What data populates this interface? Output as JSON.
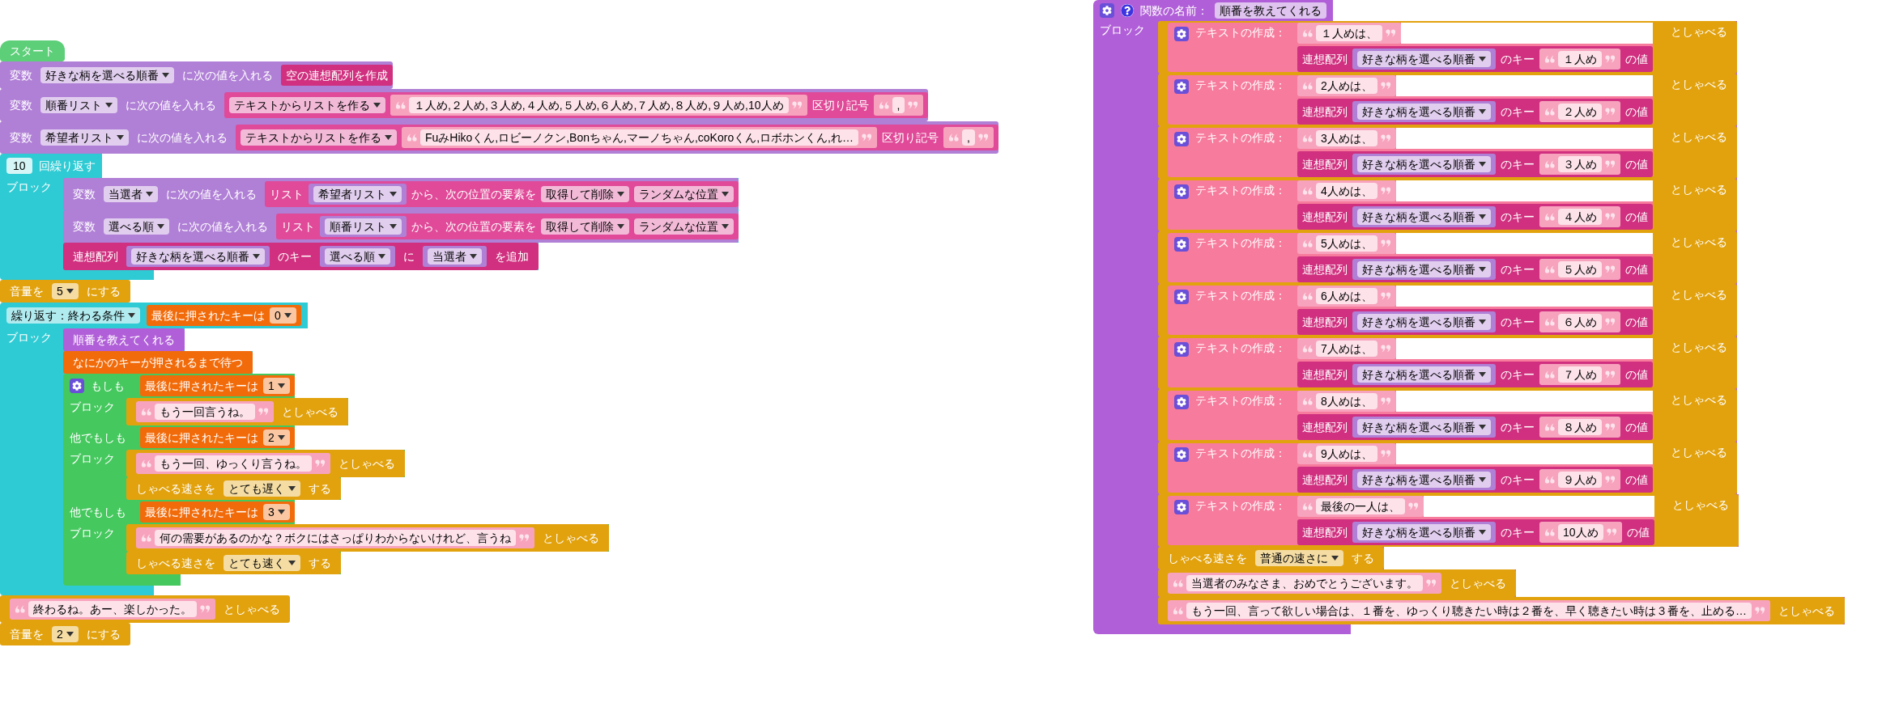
{
  "main_script": [
    {
      "kind": "hat",
      "color": "#5ccf78",
      "parts": [
        {
          "kind": "label",
          "text": "スタート"
        }
      ]
    },
    {
      "kind": "statement",
      "color": "#b07fd6",
      "parts": [
        {
          "kind": "label",
          "text": "変数"
        },
        {
          "kind": "dropdown",
          "text": "好きな柄を選べる順番"
        },
        {
          "kind": "label",
          "text": "に次の値を入れる"
        },
        {
          "kind": "value",
          "color": "#d0307f",
          "parts": [
            {
              "kind": "label",
              "text": "空の連想配列を作成"
            }
          ]
        }
      ]
    },
    {
      "kind": "statement",
      "color": "#b07fd6",
      "parts": [
        {
          "kind": "label",
          "text": "変数"
        },
        {
          "kind": "dropdown",
          "text": "順番リスト"
        },
        {
          "kind": "label",
          "text": "に次の値を入れる"
        },
        {
          "kind": "value",
          "color": "#e04a98",
          "parts": [
            {
              "kind": "dropdown",
              "text": "テキストからリストを作る"
            },
            {
              "kind": "string",
              "text": "１人め,２人め,３人め,４人め,５人め,６人め,７人め,８人め,９人め,10人め"
            },
            {
              "kind": "label",
              "text": "区切り記号"
            },
            {
              "kind": "string",
              "text": ","
            }
          ]
        }
      ]
    },
    {
      "kind": "statement",
      "color": "#b07fd6",
      "parts": [
        {
          "kind": "label",
          "text": "変数"
        },
        {
          "kind": "dropdown",
          "text": "希望者リスト"
        },
        {
          "kind": "label",
          "text": "に次の値を入れる"
        },
        {
          "kind": "value",
          "color": "#e04a98",
          "parts": [
            {
              "kind": "dropdown",
              "text": "テキストからリストを作る"
            },
            {
              "kind": "string",
              "text": "FuみHikoくん,ロビーノクン,Bonちゃん,マーノちゃん,coKoroくん,ロボホンくん,れ…"
            },
            {
              "kind": "label",
              "text": "区切り記号"
            },
            {
              "kind": "string",
              "text": ","
            }
          ]
        }
      ]
    },
    {
      "kind": "loop",
      "color": "#2ecbd4",
      "parts": [
        {
          "kind": "number",
          "text": "10"
        },
        {
          "kind": "label",
          "text": "回繰り返す"
        }
      ],
      "body_label": "ブロック",
      "body": [
        {
          "kind": "statement",
          "color": "#b07fd6",
          "parts": [
            {
              "kind": "label",
              "text": "変数"
            },
            {
              "kind": "dropdown",
              "text": "当選者"
            },
            {
              "kind": "label",
              "text": "に次の値を入れる"
            },
            {
              "kind": "value",
              "color": "#e04a98",
              "parts": [
                {
                  "kind": "label",
                  "text": "リスト"
                },
                {
                  "kind": "value",
                  "color": "#b07fd6",
                  "parts": [
                    {
                      "kind": "dropdown",
                      "text": "希望者リスト"
                    }
                  ]
                },
                {
                  "kind": "label",
                  "text": "から、次の位置の要素を"
                },
                {
                  "kind": "dropdown",
                  "text": "取得して削除"
                },
                {
                  "kind": "dropdown",
                  "text": "ランダムな位置"
                }
              ]
            }
          ]
        },
        {
          "kind": "statement",
          "color": "#b07fd6",
          "parts": [
            {
              "kind": "label",
              "text": "変数"
            },
            {
              "kind": "dropdown",
              "text": "選べる順"
            },
            {
              "kind": "label",
              "text": "に次の値を入れる"
            },
            {
              "kind": "value",
              "color": "#e04a98",
              "parts": [
                {
                  "kind": "label",
                  "text": "リスト"
                },
                {
                  "kind": "value",
                  "color": "#b07fd6",
                  "parts": [
                    {
                      "kind": "dropdown",
                      "text": "順番リスト"
                    }
                  ]
                },
                {
                  "kind": "label",
                  "text": "から、次の位置の要素を"
                },
                {
                  "kind": "dropdown",
                  "text": "取得して削除"
                },
                {
                  "kind": "dropdown",
                  "text": "ランダムな位置"
                }
              ]
            }
          ]
        },
        {
          "kind": "statement",
          "color": "#d0307f",
          "parts": [
            {
              "kind": "label",
              "text": "連想配列"
            },
            {
              "kind": "value",
              "color": "#b07fd6",
              "parts": [
                {
                  "kind": "dropdown",
                  "text": "好きな柄を選べる順番"
                }
              ]
            },
            {
              "kind": "label",
              "text": "のキー"
            },
            {
              "kind": "value",
              "color": "#b07fd6",
              "parts": [
                {
                  "kind": "dropdown",
                  "text": "選べる順"
                }
              ]
            },
            {
              "kind": "label",
              "text": "に"
            },
            {
              "kind": "value",
              "color": "#b07fd6",
              "parts": [
                {
                  "kind": "dropdown",
                  "text": "当選者"
                }
              ]
            },
            {
              "kind": "label",
              "text": "を追加"
            }
          ]
        }
      ]
    },
    {
      "kind": "statement",
      "color": "#e2a20d",
      "parts": [
        {
          "kind": "label",
          "text": "音量を"
        },
        {
          "kind": "dropdown",
          "text": "5"
        },
        {
          "kind": "label",
          "text": "にする"
        }
      ]
    },
    {
      "kind": "loop",
      "color": "#2ecbd4",
      "parts": [
        {
          "kind": "dropdown",
          "text": "繰り返す：終わる条件"
        },
        {
          "kind": "value",
          "color": "#f26b0a",
          "parts": [
            {
              "kind": "label",
              "text": "最後に押されたキーは"
            },
            {
              "kind": "dropdown",
              "text": "0"
            }
          ]
        }
      ],
      "body_label": "ブロック",
      "body": [
        {
          "kind": "statement",
          "color": "#b15fd8",
          "parts": [
            {
              "kind": "label",
              "text": "順番を教えてくれる"
            }
          ]
        },
        {
          "kind": "statement",
          "color": "#f26b0a",
          "parts": [
            {
              "kind": "label",
              "text": "なにかのキーが押されるまで待つ"
            }
          ]
        },
        {
          "kind": "if",
          "color": "#45c85e",
          "clauses": [
            {
              "label": "もしも",
              "condition": {
                "kind": "value",
                "color": "#f26b0a",
                "parts": [
                  {
                    "kind": "label",
                    "text": "最後に押されたキーは"
                  },
                  {
                    "kind": "dropdown",
                    "text": "1"
                  }
                ]
              },
              "body_label": "ブロック",
              "body": [
                {
                  "kind": "statement",
                  "color": "#e2a20d",
                  "parts": [
                    {
                      "kind": "string",
                      "text": "もう一回言うね。"
                    },
                    {
                      "kind": "label",
                      "text": "としゃべる"
                    }
                  ]
                }
              ]
            },
            {
              "label": "他でもしも",
              "condition": {
                "kind": "value",
                "color": "#f26b0a",
                "parts": [
                  {
                    "kind": "label",
                    "text": "最後に押されたキーは"
                  },
                  {
                    "kind": "dropdown",
                    "text": "2"
                  }
                ]
              },
              "body_label": "ブロック",
              "body": [
                {
                  "kind": "statement",
                  "color": "#e2a20d",
                  "parts": [
                    {
                      "kind": "string",
                      "text": "もう一回、ゆっくり言うね。"
                    },
                    {
                      "kind": "label",
                      "text": "としゃべる"
                    }
                  ]
                },
                {
                  "kind": "statement",
                  "color": "#e2a20d",
                  "parts": [
                    {
                      "kind": "label",
                      "text": "しゃべる速さを"
                    },
                    {
                      "kind": "dropdown",
                      "text": "とても遅く"
                    },
                    {
                      "kind": "label",
                      "text": "する"
                    }
                  ]
                }
              ]
            },
            {
              "label": "他でもしも",
              "condition": {
                "kind": "value",
                "color": "#f26b0a",
                "parts": [
                  {
                    "kind": "label",
                    "text": "最後に押されたキーは"
                  },
                  {
                    "kind": "dropdown",
                    "text": "3"
                  }
                ]
              },
              "body_label": "ブロック",
              "body": [
                {
                  "kind": "statement",
                  "color": "#e2a20d",
                  "parts": [
                    {
                      "kind": "string",
                      "text": "何の需要があるのかな？ボクにはさっぱりわからないけれど、言うね"
                    },
                    {
                      "kind": "label",
                      "text": "としゃべる"
                    }
                  ]
                },
                {
                  "kind": "statement",
                  "color": "#e2a20d",
                  "parts": [
                    {
                      "kind": "label",
                      "text": "しゃべる速さを"
                    },
                    {
                      "kind": "dropdown",
                      "text": "とても速く"
                    },
                    {
                      "kind": "label",
                      "text": "する"
                    }
                  ]
                }
              ]
            }
          ]
        }
      ]
    },
    {
      "kind": "statement",
      "color": "#e2a20d",
      "parts": [
        {
          "kind": "string",
          "text": "終わるね。あー、楽しかった。"
        },
        {
          "kind": "label",
          "text": "としゃべる"
        }
      ]
    },
    {
      "kind": "statement",
      "color": "#e2a20d",
      "parts": [
        {
          "kind": "label",
          "text": "音量を"
        },
        {
          "kind": "dropdown",
          "text": "2"
        },
        {
          "kind": "label",
          "text": "にする"
        }
      ]
    }
  ],
  "function_block": {
    "label": "関数の名前：",
    "name": "順番を教えてくれる",
    "body_label": "ブロック",
    "body": [
      {
        "kind": "statement",
        "color": "#e2a20d",
        "parts": [
          {
            "kind": "join",
            "color": "#f77b9c",
            "label": "テキストの作成：",
            "inputs": [
              {
                "kind": "string",
                "text": "１人めは、"
              },
              {
                "kind": "value",
                "color": "#d0307f",
                "parts": [
                  {
                    "kind": "label",
                    "text": "連想配列"
                  },
                  {
                    "kind": "value",
                    "color": "#b07fd6",
                    "parts": [
                      {
                        "kind": "dropdown",
                        "text": "好きな柄を選べる順番"
                      }
                    ]
                  },
                  {
                    "kind": "label",
                    "text": "のキー"
                  },
                  {
                    "kind": "string",
                    "text": "１人め"
                  },
                  {
                    "kind": "label",
                    "text": "の値"
                  }
                ]
              }
            ]
          },
          {
            "kind": "label",
            "text": "としゃべる"
          }
        ]
      },
      {
        "kind": "statement",
        "color": "#e2a20d",
        "parts": [
          {
            "kind": "join",
            "color": "#f77b9c",
            "label": "テキストの作成：",
            "inputs": [
              {
                "kind": "string",
                "text": "2人めは、"
              },
              {
                "kind": "value",
                "color": "#d0307f",
                "parts": [
                  {
                    "kind": "label",
                    "text": "連想配列"
                  },
                  {
                    "kind": "value",
                    "color": "#b07fd6",
                    "parts": [
                      {
                        "kind": "dropdown",
                        "text": "好きな柄を選べる順番"
                      }
                    ]
                  },
                  {
                    "kind": "label",
                    "text": "のキー"
                  },
                  {
                    "kind": "string",
                    "text": "２人め"
                  },
                  {
                    "kind": "label",
                    "text": "の値"
                  }
                ]
              }
            ]
          },
          {
            "kind": "label",
            "text": "としゃべる"
          }
        ]
      },
      {
        "kind": "statement",
        "color": "#e2a20d",
        "parts": [
          {
            "kind": "join",
            "color": "#f77b9c",
            "label": "テキストの作成：",
            "inputs": [
              {
                "kind": "string",
                "text": "3人めは、"
              },
              {
                "kind": "value",
                "color": "#d0307f",
                "parts": [
                  {
                    "kind": "label",
                    "text": "連想配列"
                  },
                  {
                    "kind": "value",
                    "color": "#b07fd6",
                    "parts": [
                      {
                        "kind": "dropdown",
                        "text": "好きな柄を選べる順番"
                      }
                    ]
                  },
                  {
                    "kind": "label",
                    "text": "のキー"
                  },
                  {
                    "kind": "string",
                    "text": "３人め"
                  },
                  {
                    "kind": "label",
                    "text": "の値"
                  }
                ]
              }
            ]
          },
          {
            "kind": "label",
            "text": "としゃべる"
          }
        ]
      },
      {
        "kind": "statement",
        "color": "#e2a20d",
        "parts": [
          {
            "kind": "join",
            "color": "#f77b9c",
            "label": "テキストの作成：",
            "inputs": [
              {
                "kind": "string",
                "text": "4人めは、"
              },
              {
                "kind": "value",
                "color": "#d0307f",
                "parts": [
                  {
                    "kind": "label",
                    "text": "連想配列"
                  },
                  {
                    "kind": "value",
                    "color": "#b07fd6",
                    "parts": [
                      {
                        "kind": "dropdown",
                        "text": "好きな柄を選べる順番"
                      }
                    ]
                  },
                  {
                    "kind": "label",
                    "text": "のキー"
                  },
                  {
                    "kind": "string",
                    "text": "４人め"
                  },
                  {
                    "kind": "label",
                    "text": "の値"
                  }
                ]
              }
            ]
          },
          {
            "kind": "label",
            "text": "としゃべる"
          }
        ]
      },
      {
        "kind": "statement",
        "color": "#e2a20d",
        "parts": [
          {
            "kind": "join",
            "color": "#f77b9c",
            "label": "テキストの作成：",
            "inputs": [
              {
                "kind": "string",
                "text": "5人めは、"
              },
              {
                "kind": "value",
                "color": "#d0307f",
                "parts": [
                  {
                    "kind": "label",
                    "text": "連想配列"
                  },
                  {
                    "kind": "value",
                    "color": "#b07fd6",
                    "parts": [
                      {
                        "kind": "dropdown",
                        "text": "好きな柄を選べる順番"
                      }
                    ]
                  },
                  {
                    "kind": "label",
                    "text": "のキー"
                  },
                  {
                    "kind": "string",
                    "text": "５人め"
                  },
                  {
                    "kind": "label",
                    "text": "の値"
                  }
                ]
              }
            ]
          },
          {
            "kind": "label",
            "text": "としゃべる"
          }
        ]
      },
      {
        "kind": "statement",
        "color": "#e2a20d",
        "parts": [
          {
            "kind": "join",
            "color": "#f77b9c",
            "label": "テキストの作成：",
            "inputs": [
              {
                "kind": "string",
                "text": "6人めは、"
              },
              {
                "kind": "value",
                "color": "#d0307f",
                "parts": [
                  {
                    "kind": "label",
                    "text": "連想配列"
                  },
                  {
                    "kind": "value",
                    "color": "#b07fd6",
                    "parts": [
                      {
                        "kind": "dropdown",
                        "text": "好きな柄を選べる順番"
                      }
                    ]
                  },
                  {
                    "kind": "label",
                    "text": "のキー"
                  },
                  {
                    "kind": "string",
                    "text": "６人め"
                  },
                  {
                    "kind": "label",
                    "text": "の値"
                  }
                ]
              }
            ]
          },
          {
            "kind": "label",
            "text": "としゃべる"
          }
        ]
      },
      {
        "kind": "statement",
        "color": "#e2a20d",
        "parts": [
          {
            "kind": "join",
            "color": "#f77b9c",
            "label": "テキストの作成：",
            "inputs": [
              {
                "kind": "string",
                "text": "7人めは、"
              },
              {
                "kind": "value",
                "color": "#d0307f",
                "parts": [
                  {
                    "kind": "label",
                    "text": "連想配列"
                  },
                  {
                    "kind": "value",
                    "color": "#b07fd6",
                    "parts": [
                      {
                        "kind": "dropdown",
                        "text": "好きな柄を選べる順番"
                      }
                    ]
                  },
                  {
                    "kind": "label",
                    "text": "のキー"
                  },
                  {
                    "kind": "string",
                    "text": "７人め"
                  },
                  {
                    "kind": "label",
                    "text": "の値"
                  }
                ]
              }
            ]
          },
          {
            "kind": "label",
            "text": "としゃべる"
          }
        ]
      },
      {
        "kind": "statement",
        "color": "#e2a20d",
        "parts": [
          {
            "kind": "join",
            "color": "#f77b9c",
            "label": "テキストの作成：",
            "inputs": [
              {
                "kind": "string",
                "text": "8人めは、"
              },
              {
                "kind": "value",
                "color": "#d0307f",
                "parts": [
                  {
                    "kind": "label",
                    "text": "連想配列"
                  },
                  {
                    "kind": "value",
                    "color": "#b07fd6",
                    "parts": [
                      {
                        "kind": "dropdown",
                        "text": "好きな柄を選べる順番"
                      }
                    ]
                  },
                  {
                    "kind": "label",
                    "text": "のキー"
                  },
                  {
                    "kind": "string",
                    "text": "８人め"
                  },
                  {
                    "kind": "label",
                    "text": "の値"
                  }
                ]
              }
            ]
          },
          {
            "kind": "label",
            "text": "としゃべる"
          }
        ]
      },
      {
        "kind": "statement",
        "color": "#e2a20d",
        "parts": [
          {
            "kind": "join",
            "color": "#f77b9c",
            "label": "テキストの作成：",
            "inputs": [
              {
                "kind": "string",
                "text": "9人めは、"
              },
              {
                "kind": "value",
                "color": "#d0307f",
                "parts": [
                  {
                    "kind": "label",
                    "text": "連想配列"
                  },
                  {
                    "kind": "value",
                    "color": "#b07fd6",
                    "parts": [
                      {
                        "kind": "dropdown",
                        "text": "好きな柄を選べる順番"
                      }
                    ]
                  },
                  {
                    "kind": "label",
                    "text": "のキー"
                  },
                  {
                    "kind": "string",
                    "text": "９人め"
                  },
                  {
                    "kind": "label",
                    "text": "の値"
                  }
                ]
              }
            ]
          },
          {
            "kind": "label",
            "text": "としゃべる"
          }
        ]
      },
      {
        "kind": "statement",
        "color": "#e2a20d",
        "parts": [
          {
            "kind": "join",
            "color": "#f77b9c",
            "label": "テキストの作成：",
            "inputs": [
              {
                "kind": "string",
                "text": "最後の一人は、"
              },
              {
                "kind": "value",
                "color": "#d0307f",
                "parts": [
                  {
                    "kind": "label",
                    "text": "連想配列"
                  },
                  {
                    "kind": "value",
                    "color": "#b07fd6",
                    "parts": [
                      {
                        "kind": "dropdown",
                        "text": "好きな柄を選べる順番"
                      }
                    ]
                  },
                  {
                    "kind": "label",
                    "text": "のキー"
                  },
                  {
                    "kind": "string",
                    "text": "10人め"
                  },
                  {
                    "kind": "label",
                    "text": "の値"
                  }
                ]
              }
            ]
          },
          {
            "kind": "label",
            "text": "としゃべる"
          }
        ]
      },
      {
        "kind": "statement",
        "color": "#e2a20d",
        "parts": [
          {
            "kind": "label",
            "text": "しゃべる速さを"
          },
          {
            "kind": "dropdown",
            "text": "普通の速さに"
          },
          {
            "kind": "label",
            "text": "する"
          }
        ]
      },
      {
        "kind": "statement",
        "color": "#e2a20d",
        "parts": [
          {
            "kind": "string",
            "text": "当選者のみなさま、おめでとうございます。"
          },
          {
            "kind": "label",
            "text": "としゃべる"
          }
        ]
      },
      {
        "kind": "statement",
        "color": "#e2a20d",
        "parts": [
          {
            "kind": "string",
            "text": "もう一回、言って欲しい場合は、１番を、ゆっくり聴きたい時は２番を、早く聴きたい時は３番を、止める…"
          },
          {
            "kind": "label",
            "text": "としゃべる"
          }
        ]
      }
    ]
  }
}
